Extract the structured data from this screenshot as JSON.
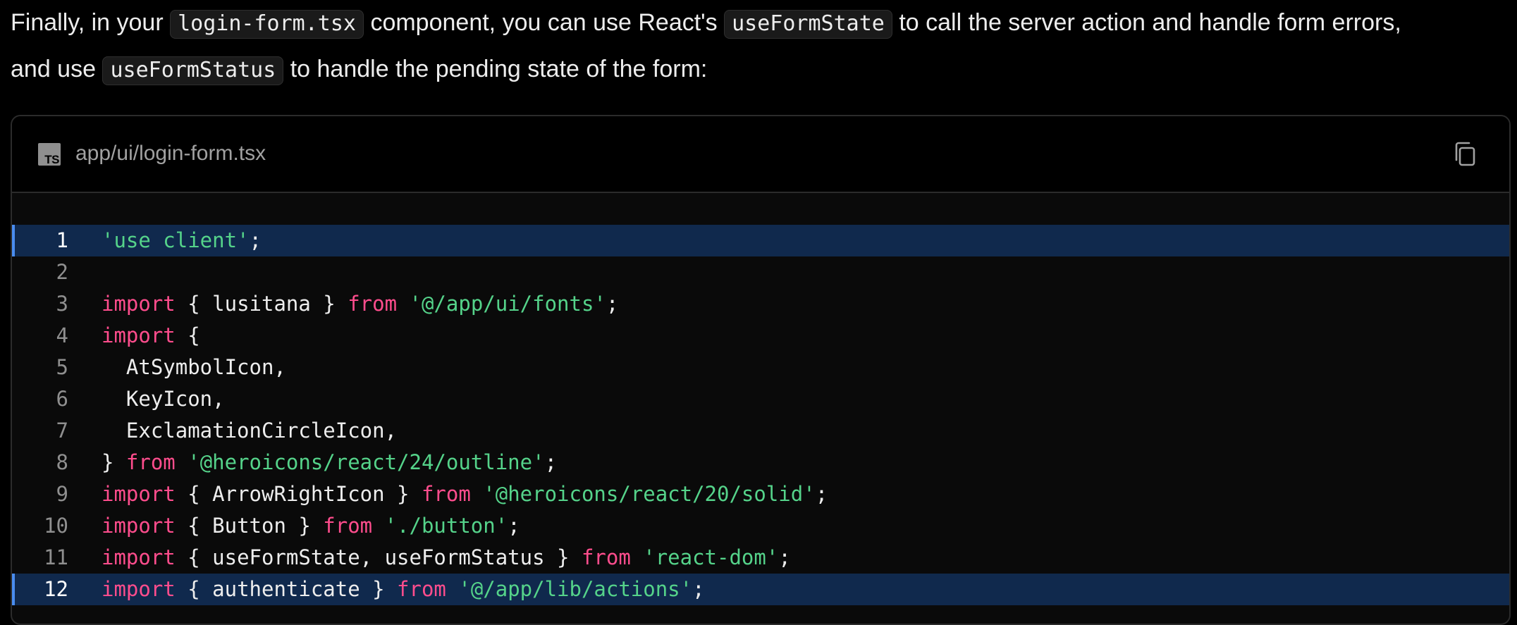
{
  "prose": {
    "line1": [
      {
        "type": "text",
        "value": "Finally, in your "
      },
      {
        "type": "code",
        "value": "login-form.tsx"
      },
      {
        "type": "text",
        "value": " component, you can use React's "
      },
      {
        "type": "code",
        "value": "useFormState"
      },
      {
        "type": "text",
        "value": " to call the server action and handle form errors,"
      }
    ],
    "line2": [
      {
        "type": "text",
        "value": "and use "
      },
      {
        "type": "code",
        "value": "useFormStatus"
      },
      {
        "type": "text",
        "value": " to handle the pending state of the form:"
      }
    ]
  },
  "code_block": {
    "language_badge": "TS",
    "filename": "app/ui/login-form.tsx",
    "copy_icon": "copy-icon",
    "colors": {
      "keyword": "#ff4d8d",
      "string": "#55d38a",
      "highlight": "#10294d",
      "highlight_bar": "#4a8df0"
    },
    "lines": [
      {
        "n": "1",
        "hl": true,
        "tokens": [
          [
            "str",
            "'use client'"
          ],
          [
            "pn",
            ";"
          ]
        ]
      },
      {
        "n": "2",
        "hl": false,
        "tokens": []
      },
      {
        "n": "3",
        "hl": false,
        "tokens": [
          [
            "kw",
            "import"
          ],
          [
            "pn",
            " { lusitana } "
          ],
          [
            "kw",
            "from"
          ],
          [
            "pn",
            " "
          ],
          [
            "str",
            "'@/app/ui/fonts'"
          ],
          [
            "pn",
            ";"
          ]
        ]
      },
      {
        "n": "4",
        "hl": false,
        "tokens": [
          [
            "kw",
            "import"
          ],
          [
            "pn",
            " {"
          ]
        ]
      },
      {
        "n": "5",
        "hl": false,
        "tokens": [
          [
            "pn",
            "  AtSymbolIcon,"
          ]
        ]
      },
      {
        "n": "6",
        "hl": false,
        "tokens": [
          [
            "pn",
            "  KeyIcon,"
          ]
        ]
      },
      {
        "n": "7",
        "hl": false,
        "tokens": [
          [
            "pn",
            "  ExclamationCircleIcon,"
          ]
        ]
      },
      {
        "n": "8",
        "hl": false,
        "tokens": [
          [
            "pn",
            "} "
          ],
          [
            "kw",
            "from"
          ],
          [
            "pn",
            " "
          ],
          [
            "str",
            "'@heroicons/react/24/outline'"
          ],
          [
            "pn",
            ";"
          ]
        ]
      },
      {
        "n": "9",
        "hl": false,
        "tokens": [
          [
            "kw",
            "import"
          ],
          [
            "pn",
            " { ArrowRightIcon } "
          ],
          [
            "kw",
            "from"
          ],
          [
            "pn",
            " "
          ],
          [
            "str",
            "'@heroicons/react/20/solid'"
          ],
          [
            "pn",
            ";"
          ]
        ]
      },
      {
        "n": "10",
        "hl": false,
        "tokens": [
          [
            "kw",
            "import"
          ],
          [
            "pn",
            " { Button } "
          ],
          [
            "kw",
            "from"
          ],
          [
            "pn",
            " "
          ],
          [
            "str",
            "'./button'"
          ],
          [
            "pn",
            ";"
          ]
        ]
      },
      {
        "n": "11",
        "hl": false,
        "tokens": [
          [
            "kw",
            "import"
          ],
          [
            "pn",
            " { useFormState, useFormStatus } "
          ],
          [
            "kw",
            "from"
          ],
          [
            "pn",
            " "
          ],
          [
            "str",
            "'react-dom'"
          ],
          [
            "pn",
            ";"
          ]
        ]
      },
      {
        "n": "12",
        "hl": true,
        "tokens": [
          [
            "kw",
            "import"
          ],
          [
            "pn",
            " { authenticate } "
          ],
          [
            "kw",
            "from"
          ],
          [
            "pn",
            " "
          ],
          [
            "str",
            "'@/app/lib/actions'"
          ],
          [
            "pn",
            ";"
          ]
        ]
      }
    ]
  }
}
